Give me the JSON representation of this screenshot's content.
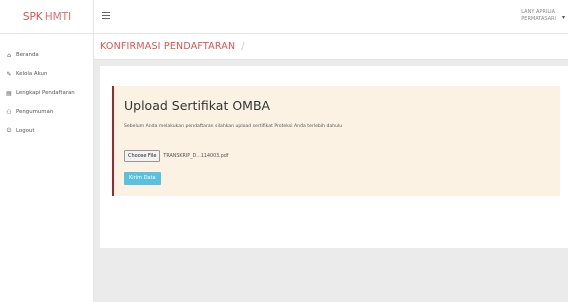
{
  "brand": {
    "part1": "SPK",
    "part2": "HMTI"
  },
  "sidebar": {
    "items": [
      {
        "label": "Beranda",
        "icon": "home-icon",
        "glyph": "⌂"
      },
      {
        "label": "Kelola Akun",
        "icon": "edit-icon",
        "glyph": "✎"
      },
      {
        "label": "Lengkapi Pendaftaran",
        "icon": "card-icon",
        "glyph": "▤"
      },
      {
        "label": "Pengumuman",
        "icon": "users-icon",
        "glyph": "⚇"
      },
      {
        "label": "Logout",
        "icon": "power-icon",
        "glyph": "⏻"
      }
    ]
  },
  "header": {
    "user_line1": "LANY APRILIA",
    "user_line2": "PERMATASARI"
  },
  "breadcrumb": {
    "title": "KONFIRMASI PENDAFTARAN",
    "separator": "/"
  },
  "upload": {
    "heading": "Upload Sertifikat OMBA",
    "description": "Sebelum Anda melakukan pendaftaran silahkan upload sertifikat Proteksi Anda terlebih dahulu",
    "choose_file_label": "Choose File",
    "file_name": "TRANSKRIP_D...114003.pdf",
    "submit_label": "Kirim Data"
  },
  "colors": {
    "brand": "#d9534f",
    "alert_bg": "#fcf2e4",
    "alert_border": "#9b2a2a",
    "submit_bg": "#5bc0de"
  }
}
